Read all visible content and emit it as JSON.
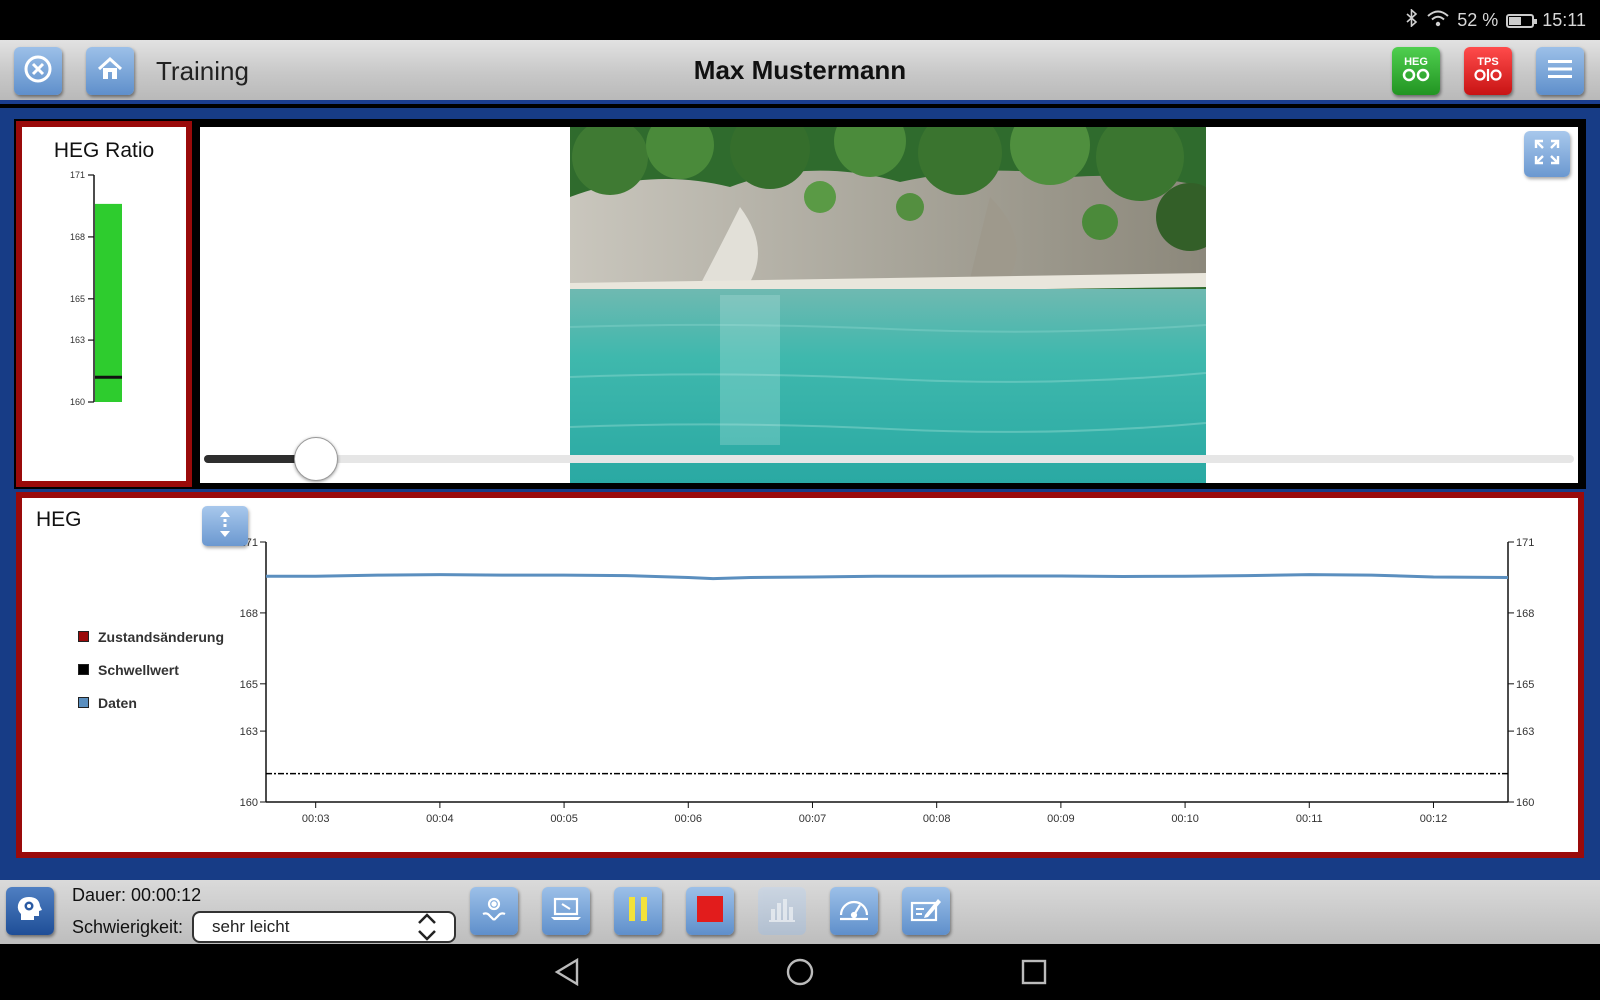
{
  "status_bar": {
    "battery": "52 %",
    "time": "15:11"
  },
  "header": {
    "screen_title": "Training",
    "user_name": "Max Mustermann",
    "heg_badge": "HEG",
    "tps_badge": "TPS"
  },
  "ratio_panel": {
    "title": "HEG Ratio"
  },
  "media": {
    "seek_progress": 0.082
  },
  "heg_panel": {
    "title": "HEG",
    "legend": [
      {
        "label": "Zustandsänderung",
        "color": "#9a0a0a"
      },
      {
        "label": "Schwellwert",
        "color": "#000000"
      },
      {
        "label": "Daten",
        "color": "#5b8fbf"
      }
    ]
  },
  "chart_data": [
    {
      "type": "bar",
      "title": "HEG Ratio",
      "ylim": [
        160,
        171
      ],
      "yticks": [
        "171",
        "168",
        "165",
        "163",
        "160"
      ],
      "value": 169.6,
      "threshold": 161.2,
      "bar_color": "#2ecc2e"
    },
    {
      "type": "line",
      "title": "HEG",
      "x_ticks": [
        "00:03",
        "00:04",
        "00:05",
        "00:06",
        "00:07",
        "00:08",
        "00:09",
        "00:10",
        "00:11",
        "00:12"
      ],
      "xlim": [
        2.6,
        12.6
      ],
      "ylim": [
        160,
        171
      ],
      "yticks_left": [
        "171",
        "168",
        "165",
        "163",
        "160"
      ],
      "yticks_right": [
        "171",
        "168",
        "165",
        "163",
        "160"
      ],
      "series": [
        {
          "name": "Daten",
          "color": "#5b8fbf",
          "x": [
            2.6,
            3.0,
            3.5,
            4.0,
            4.5,
            5.0,
            5.5,
            6.0,
            6.2,
            6.5,
            7.0,
            7.5,
            8.0,
            8.5,
            9.0,
            9.5,
            10.0,
            10.5,
            11.0,
            11.5,
            12.0,
            12.6
          ],
          "values": [
            169.55,
            169.55,
            169.6,
            169.62,
            169.6,
            169.6,
            169.58,
            169.5,
            169.45,
            169.5,
            169.52,
            169.55,
            169.55,
            169.56,
            169.56,
            169.54,
            169.55,
            169.58,
            169.62,
            169.6,
            169.52,
            169.5
          ]
        },
        {
          "name": "Schwellwert",
          "color": "#000000",
          "x": [
            2.6,
            12.6
          ],
          "values": [
            161.2,
            161.2
          ]
        }
      ]
    }
  ],
  "footer": {
    "duration": "Dauer: 00:00:12",
    "difficulty_label": "Schwierigkeit:",
    "difficulty_value": "sehr leicht"
  }
}
